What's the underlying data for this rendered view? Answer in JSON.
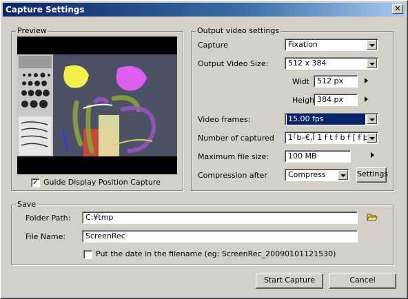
{
  "window": {
    "title": "Capture Settings",
    "close_glyph": "✕"
  },
  "preview": {
    "group_label": "Preview",
    "guide_checkbox": {
      "checked": true,
      "label": "Guide Display Position Capture"
    }
  },
  "output": {
    "group_label": "Output video settings",
    "capture": {
      "label": "Capture",
      "value": "Fixation"
    },
    "video_size": {
      "label": "Output Video Size:",
      "value": "512 x 384"
    },
    "width": {
      "label": "Widt",
      "value": "512 px"
    },
    "height": {
      "label": "Heigh",
      "value": "384 px"
    },
    "video_frames": {
      "label": "Video frames:",
      "value": "15.00 fps"
    },
    "num_captured": {
      "label": "Number of captured",
      "value": "1｢b–€‚Ĭ 1ｆtｆbｆ[ｆþ"
    },
    "max_file_size": {
      "label": "Maximum file size:",
      "value": "100 MB"
    },
    "compression": {
      "label": "Compression after",
      "value": "Compress",
      "settings_button": "Settings"
    }
  },
  "save": {
    "group_label": "Save",
    "folder": {
      "label": "Folder Path:",
      "value": "C:¥tmp"
    },
    "file_name": {
      "label": "File Name:",
      "value": "ScreenRec"
    },
    "date_checkbox": {
      "checked": false,
      "label": "Put the date in the filename (eg: ScreenRec_20090101121530)"
    }
  },
  "buttons": {
    "start": "Start Capture",
    "cancel": "Cancel"
  },
  "icons": {
    "folder": "folder-open-icon",
    "arrow": "arrow-right-icon",
    "dropdown": "chevron-down-icon"
  }
}
